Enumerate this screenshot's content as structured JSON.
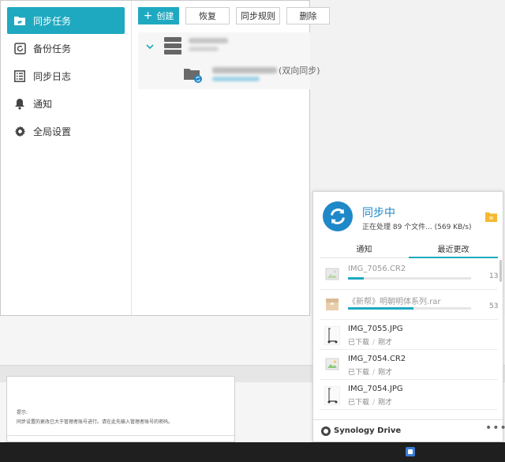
{
  "sidebar": {
    "items": [
      {
        "label": "同步任务",
        "icon": "sync-task-icon"
      },
      {
        "label": "备份任务",
        "icon": "backup-icon"
      },
      {
        "label": "同步日志",
        "icon": "log-list-icon"
      },
      {
        "label": "通知",
        "icon": "bell-icon"
      },
      {
        "label": "全局设置",
        "icon": "gear-icon"
      }
    ]
  },
  "toolbar": {
    "create_label": "创建",
    "restore_label": "恢复",
    "rules_label": "同步规则",
    "delete_label": "删除"
  },
  "task": {
    "mode": "(双向同步)"
  },
  "background_doc": {
    "line1": "提示:",
    "line2": "同步设置的更改已大于管理者账号进行。请在此先输入管理者账号的密码。"
  },
  "popup": {
    "status_title": "同步中",
    "status_detail": "正在处理 89 个文件... (569 KB/s)",
    "tabs": [
      "通知",
      "最近更改"
    ],
    "active_tab": 1,
    "items": [
      {
        "name": "IMG_7056.CR2",
        "progress": 13,
        "progress_label": "13",
        "thumb": "image-icon",
        "in_progress": true
      },
      {
        "name": "《新帮》明朝明体系列.rar",
        "progress": 53,
        "progress_label": "53",
        "thumb": "archive-icon",
        "in_progress": true
      },
      {
        "name": "IMG_7055.JPG",
        "status": "已下载",
        "time": "刚才",
        "thumb": "scooter-photo-icon"
      },
      {
        "name": "IMG_7054.CR2",
        "status": "已下载",
        "time": "刚才",
        "thumb": "image-icon"
      },
      {
        "name": "IMG_7054.JPG",
        "status": "已下载",
        "time": "刚才",
        "thumb": "scooter-photo-icon"
      }
    ],
    "brand": "Synology Drive",
    "more": "•••"
  },
  "colors": {
    "accent": "#1fa9c0",
    "sync_blue": "#1e88c9",
    "folder_yellow": "#f5b82e"
  }
}
